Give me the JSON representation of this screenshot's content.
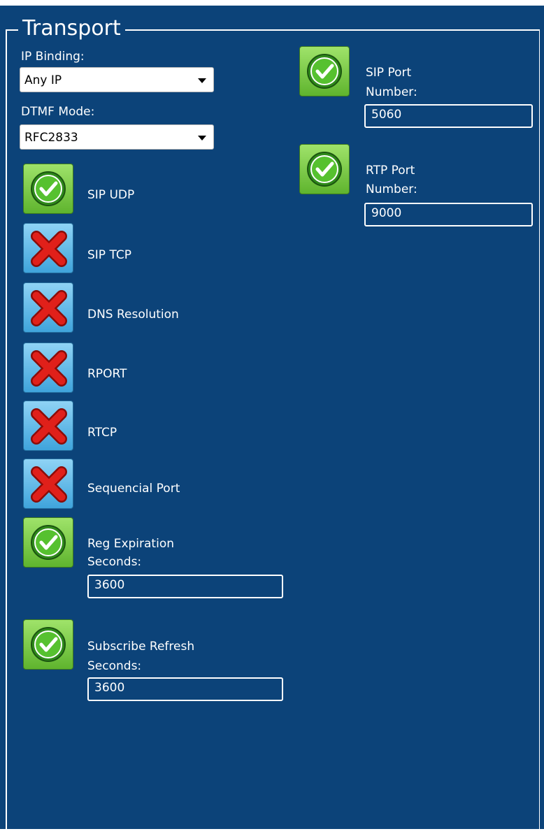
{
  "section": {
    "title": "Transport"
  },
  "ip_binding": {
    "label": "IP Binding:",
    "value": "Any IP"
  },
  "dtmf_mode": {
    "label": "DTMF Mode:",
    "value": "RFC2833"
  },
  "options": [
    {
      "label": "SIP UDP",
      "enabled": true,
      "icon": "check-icon"
    },
    {
      "label": "SIP TCP",
      "enabled": false,
      "icon": "cross-icon"
    },
    {
      "label": "DNS Resolution",
      "enabled": false,
      "icon": "cross-icon"
    },
    {
      "label": "RPORT",
      "enabled": false,
      "icon": "cross-icon"
    },
    {
      "label": "RTCP",
      "enabled": false,
      "icon": "cross-icon"
    },
    {
      "label": "Sequencial Port",
      "enabled": false,
      "icon": "cross-icon"
    }
  ],
  "reg_expiration": {
    "label_line1": "Reg Expiration",
    "label_line2": "Seconds:",
    "value": "3600",
    "enabled": true
  },
  "subscribe_refresh": {
    "label_line1": "Subscribe Refresh",
    "label_line2": "Seconds:",
    "value": "3600",
    "enabled": true
  },
  "sip_port": {
    "label_line1": "SIP Port",
    "label_line2": "Number:",
    "value": "5060",
    "enabled": true
  },
  "rtp_port": {
    "label_line1": "RTP Port",
    "label_line2": "Number:",
    "value": "9000",
    "enabled": true
  },
  "colors": {
    "panel_background": "#0c4379",
    "toggle_on": "#6cc33b",
    "toggle_off": "#4fb0e3",
    "cross": "#e0201a"
  }
}
